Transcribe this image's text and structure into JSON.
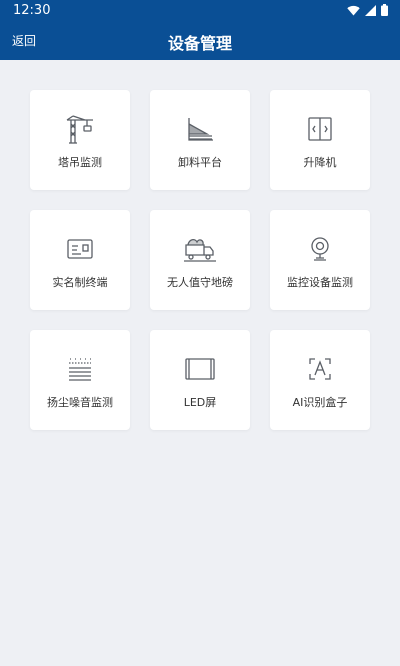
{
  "status_bar": {
    "time": "12:30"
  },
  "nav": {
    "back_label": "返回",
    "title": "设备管理"
  },
  "colors": {
    "header": "#0a4f95",
    "background": "#eef0f4",
    "icon": "#5a5f66"
  },
  "devices": [
    {
      "label": "塔吊监测",
      "icon": "tower-crane-icon"
    },
    {
      "label": "卸料平台",
      "icon": "unloading-platform-icon"
    },
    {
      "label": "升降机",
      "icon": "elevator-icon"
    },
    {
      "label": "实名制终端",
      "icon": "id-card-terminal-icon"
    },
    {
      "label": "无人值守地磅",
      "icon": "truck-scale-icon"
    },
    {
      "label": "监控设备监测",
      "icon": "camera-icon"
    },
    {
      "label": "扬尘噪音监测",
      "icon": "dust-noise-icon"
    },
    {
      "label": "LED屏",
      "icon": "led-screen-icon"
    },
    {
      "label": "AI识别盒子",
      "icon": "ai-box-icon"
    }
  ]
}
